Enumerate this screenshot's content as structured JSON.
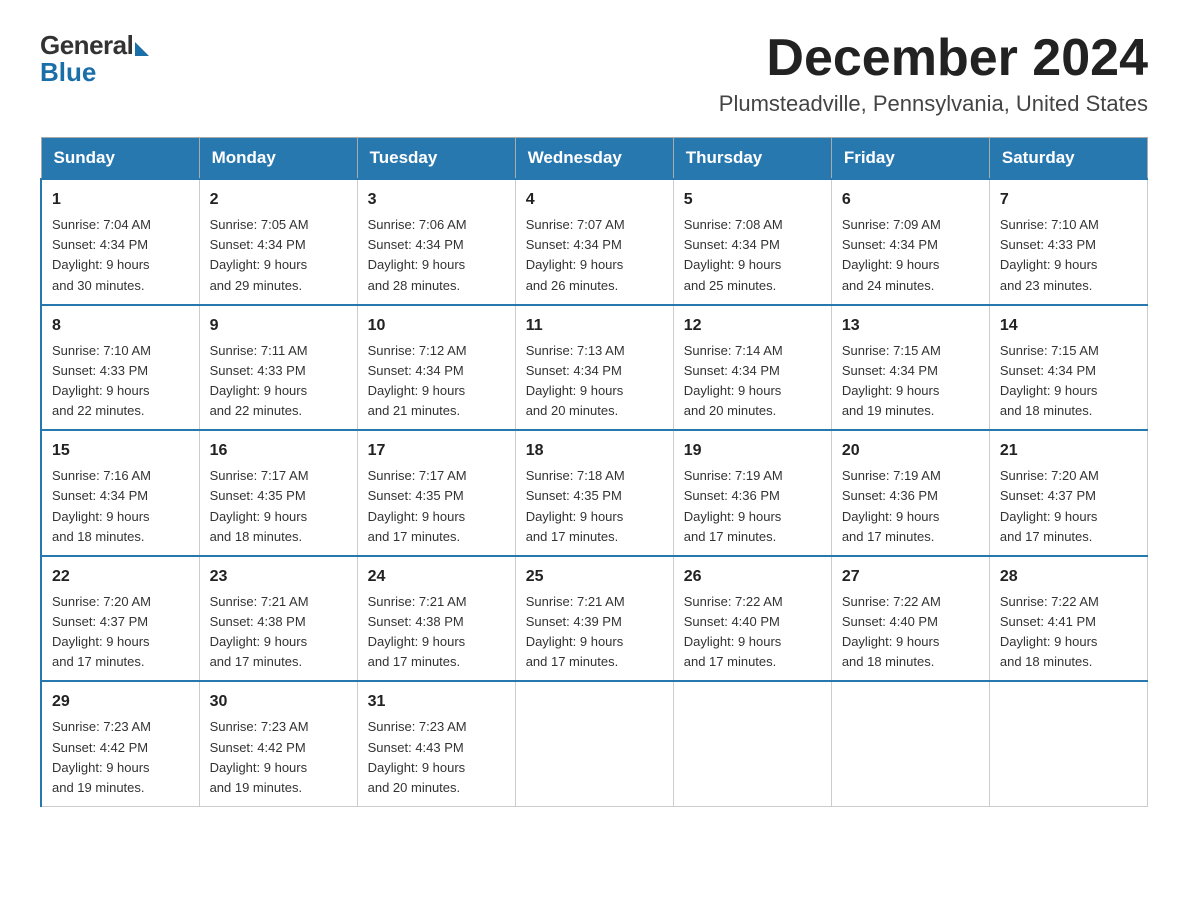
{
  "logo": {
    "general": "General",
    "blue": "Blue"
  },
  "title": "December 2024",
  "location": "Plumsteadville, Pennsylvania, United States",
  "weekdays": [
    "Sunday",
    "Monday",
    "Tuesday",
    "Wednesday",
    "Thursday",
    "Friday",
    "Saturday"
  ],
  "weeks": [
    [
      {
        "day": "1",
        "sunrise": "7:04 AM",
        "sunset": "4:34 PM",
        "daylight": "9 hours and 30 minutes."
      },
      {
        "day": "2",
        "sunrise": "7:05 AM",
        "sunset": "4:34 PM",
        "daylight": "9 hours and 29 minutes."
      },
      {
        "day": "3",
        "sunrise": "7:06 AM",
        "sunset": "4:34 PM",
        "daylight": "9 hours and 28 minutes."
      },
      {
        "day": "4",
        "sunrise": "7:07 AM",
        "sunset": "4:34 PM",
        "daylight": "9 hours and 26 minutes."
      },
      {
        "day": "5",
        "sunrise": "7:08 AM",
        "sunset": "4:34 PM",
        "daylight": "9 hours and 25 minutes."
      },
      {
        "day": "6",
        "sunrise": "7:09 AM",
        "sunset": "4:34 PM",
        "daylight": "9 hours and 24 minutes."
      },
      {
        "day": "7",
        "sunrise": "7:10 AM",
        "sunset": "4:33 PM",
        "daylight": "9 hours and 23 minutes."
      }
    ],
    [
      {
        "day": "8",
        "sunrise": "7:10 AM",
        "sunset": "4:33 PM",
        "daylight": "9 hours and 22 minutes."
      },
      {
        "day": "9",
        "sunrise": "7:11 AM",
        "sunset": "4:33 PM",
        "daylight": "9 hours and 22 minutes."
      },
      {
        "day": "10",
        "sunrise": "7:12 AM",
        "sunset": "4:34 PM",
        "daylight": "9 hours and 21 minutes."
      },
      {
        "day": "11",
        "sunrise": "7:13 AM",
        "sunset": "4:34 PM",
        "daylight": "9 hours and 20 minutes."
      },
      {
        "day": "12",
        "sunrise": "7:14 AM",
        "sunset": "4:34 PM",
        "daylight": "9 hours and 20 minutes."
      },
      {
        "day": "13",
        "sunrise": "7:15 AM",
        "sunset": "4:34 PM",
        "daylight": "9 hours and 19 minutes."
      },
      {
        "day": "14",
        "sunrise": "7:15 AM",
        "sunset": "4:34 PM",
        "daylight": "9 hours and 18 minutes."
      }
    ],
    [
      {
        "day": "15",
        "sunrise": "7:16 AM",
        "sunset": "4:34 PM",
        "daylight": "9 hours and 18 minutes."
      },
      {
        "day": "16",
        "sunrise": "7:17 AM",
        "sunset": "4:35 PM",
        "daylight": "9 hours and 18 minutes."
      },
      {
        "day": "17",
        "sunrise": "7:17 AM",
        "sunset": "4:35 PM",
        "daylight": "9 hours and 17 minutes."
      },
      {
        "day": "18",
        "sunrise": "7:18 AM",
        "sunset": "4:35 PM",
        "daylight": "9 hours and 17 minutes."
      },
      {
        "day": "19",
        "sunrise": "7:19 AM",
        "sunset": "4:36 PM",
        "daylight": "9 hours and 17 minutes."
      },
      {
        "day": "20",
        "sunrise": "7:19 AM",
        "sunset": "4:36 PM",
        "daylight": "9 hours and 17 minutes."
      },
      {
        "day": "21",
        "sunrise": "7:20 AM",
        "sunset": "4:37 PM",
        "daylight": "9 hours and 17 minutes."
      }
    ],
    [
      {
        "day": "22",
        "sunrise": "7:20 AM",
        "sunset": "4:37 PM",
        "daylight": "9 hours and 17 minutes."
      },
      {
        "day": "23",
        "sunrise": "7:21 AM",
        "sunset": "4:38 PM",
        "daylight": "9 hours and 17 minutes."
      },
      {
        "day": "24",
        "sunrise": "7:21 AM",
        "sunset": "4:38 PM",
        "daylight": "9 hours and 17 minutes."
      },
      {
        "day": "25",
        "sunrise": "7:21 AM",
        "sunset": "4:39 PM",
        "daylight": "9 hours and 17 minutes."
      },
      {
        "day": "26",
        "sunrise": "7:22 AM",
        "sunset": "4:40 PM",
        "daylight": "9 hours and 17 minutes."
      },
      {
        "day": "27",
        "sunrise": "7:22 AM",
        "sunset": "4:40 PM",
        "daylight": "9 hours and 18 minutes."
      },
      {
        "day": "28",
        "sunrise": "7:22 AM",
        "sunset": "4:41 PM",
        "daylight": "9 hours and 18 minutes."
      }
    ],
    [
      {
        "day": "29",
        "sunrise": "7:23 AM",
        "sunset": "4:42 PM",
        "daylight": "9 hours and 19 minutes."
      },
      {
        "day": "30",
        "sunrise": "7:23 AM",
        "sunset": "4:42 PM",
        "daylight": "9 hours and 19 minutes."
      },
      {
        "day": "31",
        "sunrise": "7:23 AM",
        "sunset": "4:43 PM",
        "daylight": "9 hours and 20 minutes."
      },
      null,
      null,
      null,
      null
    ]
  ],
  "labels": {
    "sunrise": "Sunrise:",
    "sunset": "Sunset:",
    "daylight": "Daylight:"
  }
}
